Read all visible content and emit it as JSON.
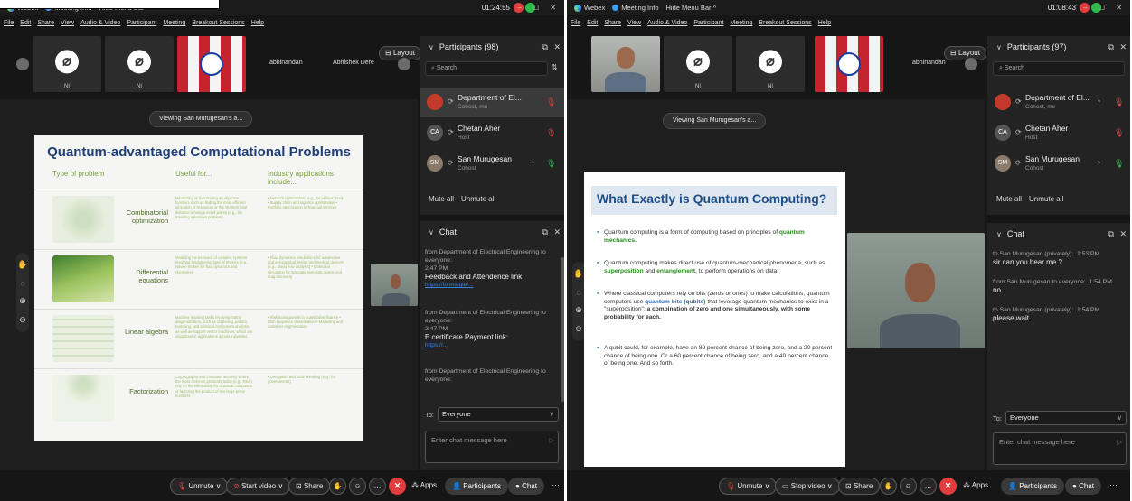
{
  "win1": {
    "title": {
      "app": "Webex",
      "meeting_info": "Meeting Info",
      "hide_menu": "Hide Menu Bar ^",
      "clock": "01:24:55"
    },
    "menu": [
      "File",
      "Edit",
      "Share",
      "View",
      "Audio & Video",
      "Participant",
      "Meeting",
      "Breakout Sessions",
      "Help"
    ],
    "strip": {
      "tile_name_1": "NI",
      "tile_name_2": "NI",
      "name_a": "abhinandan",
      "name_b": "Abhishek Dere",
      "layout": "Layout"
    },
    "viewing": "Viewing San Murugesan's a...",
    "slide": {
      "title": "Quantum-advantaged Computational Problems",
      "col1": "Type of problem",
      "col2": "Useful for...",
      "col3": "Industry applications include...",
      "rows": [
        {
          "label": "Combinatorial optimization",
          "desc": "Minimizing or maximizing an objective function, such as finding the most efficient allocation of resources or the shortest total distance among a set of points (e.g., the traveling salesman problem)",
          "ind": "• Network optimization (e.g., for airlines, taxis) • Supply chain and logistics optimization • Portfolio optimization in financial services"
        },
        {
          "label": "Differential equations",
          "desc": "Modeling the behavior of complex systems involving fundamental laws of physics (e.g., Navier-Stokes for fluid dynamics and chemistry)",
          "ind": "• Fluid dynamics simulations for automotive and aeronautical design and medical devices (e.g., blood flow analysis) • Molecular simulation for specialty materials design and drug discovery"
        },
        {
          "label": "Linear algebra",
          "desc": "Machine learning tasks involving matrix diagonalization, such as clustering, pattern matching, and principal component analysis, as well as support vector machines, which are ubiquitous in applications across industries",
          "ind": "• Risk management in quantitative finance • DNA sequence classification • Marketing and customer segmentation"
        },
        {
          "label": "Factorization",
          "desc": "Cryptography and computer security, where the most common protocols today (e.g., RSA) rely on the infeasibility for classical computers of factoring the product of two large prime numbers",
          "ind": "• Decryption and code breaking (e.g., for governments)"
        }
      ]
    },
    "participants": {
      "header": "Participants (98)",
      "search": "Search",
      "list": [
        {
          "initials": "",
          "name": "Department of El...",
          "role": "Cohost, me"
        },
        {
          "initials": "CA",
          "name": "Chetan Aher",
          "role": "Host"
        },
        {
          "initials": "SM",
          "name": "San Murugesan",
          "role": "Cohost"
        }
      ],
      "mute_all": "Mute all",
      "unmute_all": "Unmute all"
    },
    "chat": {
      "header": "Chat",
      "messages": [
        {
          "meta": "from Department of Electrical Engineering to everyone:",
          "time": "2:47 PM",
          "text": "Feedback and Attendence link",
          "link": "https://forms.gle/..."
        },
        {
          "meta": "from Department of Electrical Engineering to everyone:",
          "time": "2:47 PM",
          "text": "E certificate Payment link:",
          "link": "https://..."
        },
        {
          "meta": "from Department of Electrical Engineering to everyone:",
          "time": "",
          "text": "",
          "link": ""
        }
      ],
      "to_label": "To:",
      "to_value": "Everyone",
      "input_placeholder": "Enter chat message here"
    },
    "toolbar": {
      "unmute": "Unmute",
      "video": "Start video",
      "share": "Share",
      "apps": "Apps",
      "participants": "Participants",
      "chat": "Chat"
    }
  },
  "win2": {
    "title": {
      "app": "Webex",
      "meeting_info": "Meeting Info",
      "hide_menu": "Hide Menu Bar ^",
      "clock": "01:08:43"
    },
    "menu": [
      "File",
      "Edit",
      "Share",
      "View",
      "Audio & Video",
      "Participant",
      "Meeting",
      "Breakout Sessions",
      "Help"
    ],
    "strip": {
      "tile_name_1": "NI",
      "tile_name_2": "NI",
      "name_a": "abhinandan",
      "layout": "Layout"
    },
    "viewing": "Viewing San Murugesan's a...",
    "slide": {
      "title": "What Exactly is Quantum Computing?",
      "b1_pre": "Quantum computing is a form of computing based on principles of ",
      "b1_g": "quantum mechanics.",
      "b2_pre": "Quantum computing makes direct use of quantum-mechanical phenomena, such as ",
      "b2_g1": "superposition",
      "b2_mid": " and ",
      "b2_g2": "entanglement",
      "b2_post": ", to perform operations on data.",
      "b3_pre": "Where classical computers rely on bits (zeros or ones) to make calculations, quantum computers use ",
      "b3_g": "quantum bits (qubits)",
      "b3_mid": " that leverage quantum mechanics to exist in a \"superposition\": ",
      "b3_bold": "a combination of zero and one simultaneously, with some probability for each.",
      "b4": "A qubit could, for example, have an 80 percent chance of being zero, and a 20 percent chance of being one. Or a 60 percent chance of being zero, and a 40 percent chance of being one. And so forth."
    },
    "participants": {
      "header": "Participants (97)",
      "search": "Search",
      "list": [
        {
          "initials": "",
          "name": "Department of El...",
          "role": "Cohost, me"
        },
        {
          "initials": "CA",
          "name": "Chetan Aher",
          "role": "Host"
        },
        {
          "initials": "SM",
          "name": "San Murugesan",
          "role": "Cohost"
        }
      ],
      "mute_all": "Mute all",
      "unmute_all": "Unmute all"
    },
    "chat": {
      "header": "Chat",
      "messages": [
        {
          "meta": "to San Murugesan (privately):",
          "time": "1:53 PM",
          "text": "sir can you hear me ?"
        },
        {
          "meta": "from San Murugesan to everyone:",
          "time": "1:54 PM",
          "text": "no"
        },
        {
          "meta": "to San Murugesan (privately):",
          "time": "1:54 PM",
          "text": "please wait"
        }
      ],
      "to_label": "To:",
      "to_value": "Everyone",
      "input_placeholder": "Enter chat message here"
    },
    "toolbar": {
      "unmute": "Unmute",
      "video": "Stop video",
      "share": "Share",
      "apps": "Apps",
      "participants": "Participants",
      "chat": "Chat"
    }
  }
}
